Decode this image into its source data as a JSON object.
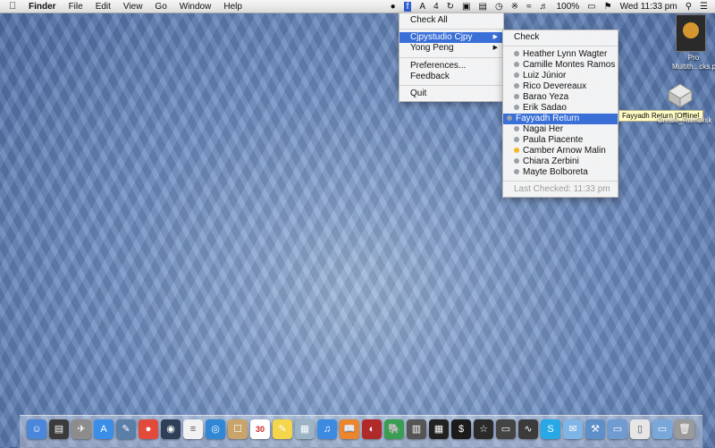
{
  "menubar": {
    "apple": "",
    "app_name": "Finder",
    "menus": [
      "File",
      "Edit",
      "View",
      "Go",
      "Window",
      "Help"
    ],
    "status": {
      "adobe_count": "4",
      "battery": "100%",
      "clock": "Wed 11:33 pm"
    }
  },
  "main_menu": {
    "check_all": "Check All",
    "account1": "Cjpystudio Cjpy",
    "account2": "Yong Peng",
    "preferences": "Preferences...",
    "feedback": "Feedback",
    "quit": "Quit"
  },
  "sub_menu": {
    "check": "Check",
    "contacts": [
      {
        "name": "Heather Lynn Wagter",
        "status": "offline"
      },
      {
        "name": "Camille Montes Ramos",
        "status": "offline"
      },
      {
        "name": "Luiz Júnior",
        "status": "offline"
      },
      {
        "name": "Rico Devereaux",
        "status": "offline"
      },
      {
        "name": "Barao Yeza",
        "status": "offline"
      },
      {
        "name": "Erik Sadao",
        "status": "offline"
      },
      {
        "name": "Fayyadh Return",
        "status": "offline"
      },
      {
        "name": "Nagai Her",
        "status": "offline"
      },
      {
        "name": "Paula Piacente",
        "status": "offline"
      },
      {
        "name": "Camber Arnow Malin",
        "status": "idle"
      },
      {
        "name": "Chiara Zerbini",
        "status": "offline"
      },
      {
        "name": "Mayte Bolboreta",
        "status": "offline"
      }
    ],
    "last_checked": "Last Checked: 11:33 pm"
  },
  "tooltip": "Fayyadh Return [Offline]",
  "desktop": {
    "pdf_label_line1": "Pro",
    "pdf_label_line2": "Multith...cks.pdf",
    "disk_label": "Create_RamDisk"
  },
  "dock": {
    "apps": [
      "finder-icon",
      "dashboard-icon",
      "launchpad-icon",
      "app-store-icon",
      "preview-icon",
      "chrome-icon",
      "camera-icon",
      "textedit-icon",
      "safari-icon",
      "contacts-icon",
      "calendar-icon",
      "stickies-icon",
      "image-capture-icon",
      "itunes-icon",
      "ibooks-icon",
      "photo-booth-icon",
      "evernote-icon",
      "server-icon",
      "varnish-icon",
      "terminal-icon",
      "istat-icon",
      "console-icon",
      "activity-monitor-icon",
      "skype-icon",
      "messages-icon",
      "xcode-icon",
      "folder-icon",
      "documents-icon",
      "downloads-icon",
      "trash-icon"
    ],
    "calendar_day": "30"
  },
  "colors": {
    "highlight": "#3a6fd8",
    "idle_dot": "#f2b825",
    "offline_dot": "#9aa0a8"
  }
}
